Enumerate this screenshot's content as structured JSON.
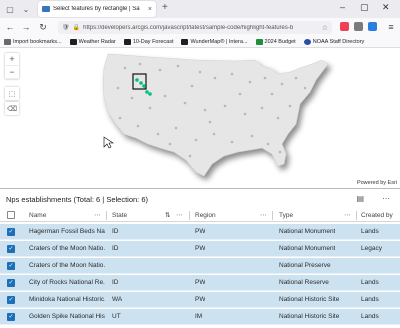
{
  "browser": {
    "tab_title": "Select features by rectangle | Sa",
    "tab_close": "×",
    "new_tab": "+",
    "url": "https://developers.arcgis.com/javascript/latest/sample-code/highlight-features-b",
    "bookmarks": [
      {
        "label": "Import bookmarks...",
        "color": "#6a6a6a"
      },
      {
        "label": "Weather Radar",
        "color": "#1f1f1f"
      },
      {
        "label": "10-Day Forecast",
        "color": "#1f1f1f"
      },
      {
        "label": "WunderMap® | Intera...",
        "color": "#1f1f1f"
      },
      {
        "label": "2024 Budget",
        "color": "#1f8f3f"
      },
      {
        "label": "NOAA Staff Directory",
        "color": "#2b4fa8"
      }
    ]
  },
  "map": {
    "zoom_in": "+",
    "zoom_out": "−",
    "attribution": "Powered by Esri"
  },
  "table": {
    "title": "Nps establishments (Total: 6 | Selection: 6)",
    "columns": [
      "Name",
      "State",
      "Region",
      "Type",
      "Created by"
    ],
    "rows": [
      {
        "checked": true,
        "name": "Hagerman Fossil Beds Nat...",
        "state": "ID",
        "region": "PW",
        "type": "National Monument",
        "created": "Lands"
      },
      {
        "checked": true,
        "name": "Craters of the Moon Natio...",
        "state": "ID",
        "region": "PW",
        "type": "National Monument",
        "created": "Legacy"
      },
      {
        "checked": true,
        "name": "Craters of the Moon Natio...",
        "state": "",
        "region": "",
        "type": "National Preserve",
        "created": ""
      },
      {
        "checked": true,
        "name": "City of Rocks National Re...",
        "state": "ID",
        "region": "PW",
        "type": "National Reserve",
        "created": "Lands"
      },
      {
        "checked": true,
        "name": "Minidoka National Historic...",
        "state": "WA",
        "region": "PW",
        "type": "National Historic Site",
        "created": "Lands"
      },
      {
        "checked": true,
        "name": "Golden Spike National His...",
        "state": "UT",
        "region": "IM",
        "type": "National Historic Site",
        "created": "Lands"
      }
    ]
  },
  "colors": {
    "selection": "#cde2f0",
    "accent": "#1e6fb8",
    "highlight": "#00c087"
  }
}
